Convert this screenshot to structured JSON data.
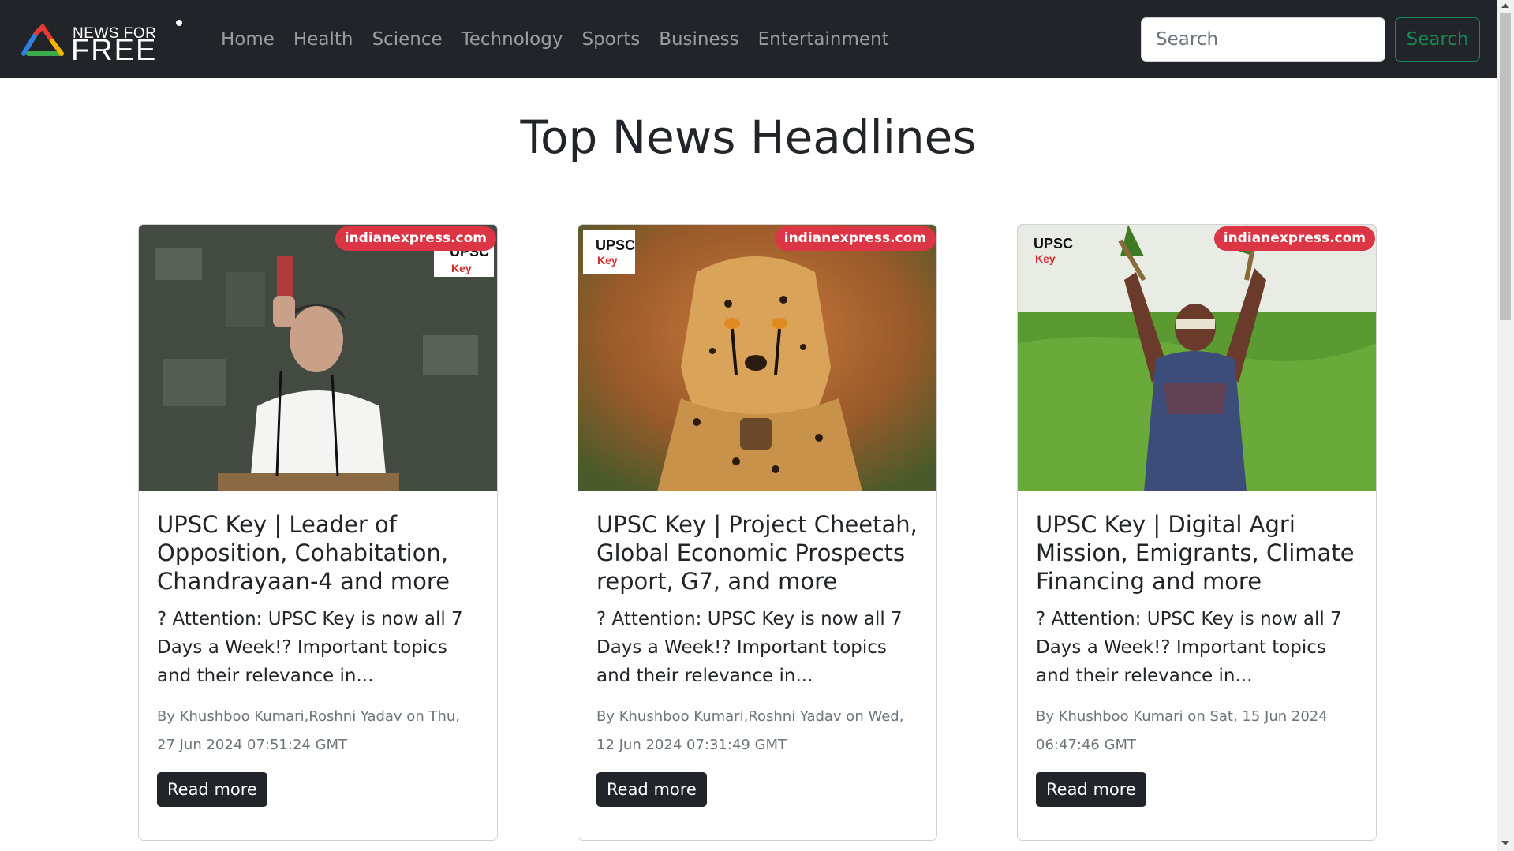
{
  "brand": {
    "line1": "NEWS FOR",
    "line2": "FREE"
  },
  "nav": {
    "items": [
      {
        "label": "Home"
      },
      {
        "label": "Health"
      },
      {
        "label": "Science"
      },
      {
        "label": "Technology"
      },
      {
        "label": "Sports"
      },
      {
        "label": "Business"
      },
      {
        "label": "Entertainment"
      }
    ]
  },
  "search": {
    "placeholder": "Search",
    "button_label": "Search"
  },
  "page": {
    "title": "Top News Headlines"
  },
  "cards": [
    {
      "source": "indianexpress.com",
      "title": "UPSC Key | Leader of Opposition, Cohabitation, Chandrayaan-4 and more",
      "description": "? Attention: UPSC Key is now all 7 Days a Week!? Important topics and their relevance in...",
      "meta": "By Khushboo Kumari,Roshni Yadav on Thu, 27 Jun 2024 07:51:24 GMT",
      "button_label": "Read more",
      "image_logo": {
        "line1": "UPSC",
        "line2": "Key"
      }
    },
    {
      "source": "indianexpress.com",
      "title": "UPSC Key | Project Cheetah, Global Economic Prospects report, G7, and more",
      "description": "? Attention: UPSC Key is now all 7 Days a Week!? Important topics and their relevance in...",
      "meta": "By Khushboo Kumari,Roshni Yadav on Wed, 12 Jun 2024 07:31:49 GMT",
      "button_label": "Read more",
      "image_logo": {
        "line1": "UPSC",
        "line2": "Key"
      }
    },
    {
      "source": "indianexpress.com",
      "title": "UPSC Key | Digital Agri Mission, Emigrants, Climate Financing and more",
      "description": "? Attention: UPSC Key is now all 7 Days a Week!? Important topics and their relevance in...",
      "meta": "By Khushboo Kumari on Sat, 15 Jun 2024 06:47:46 GMT",
      "button_label": "Read more",
      "image_logo": {
        "line1": "UPSC",
        "line2": "Key"
      }
    }
  ],
  "colors": {
    "navbar_bg": "#212529",
    "search_button": "#198754",
    "badge": "#dc3545",
    "button_bg": "#212529"
  }
}
